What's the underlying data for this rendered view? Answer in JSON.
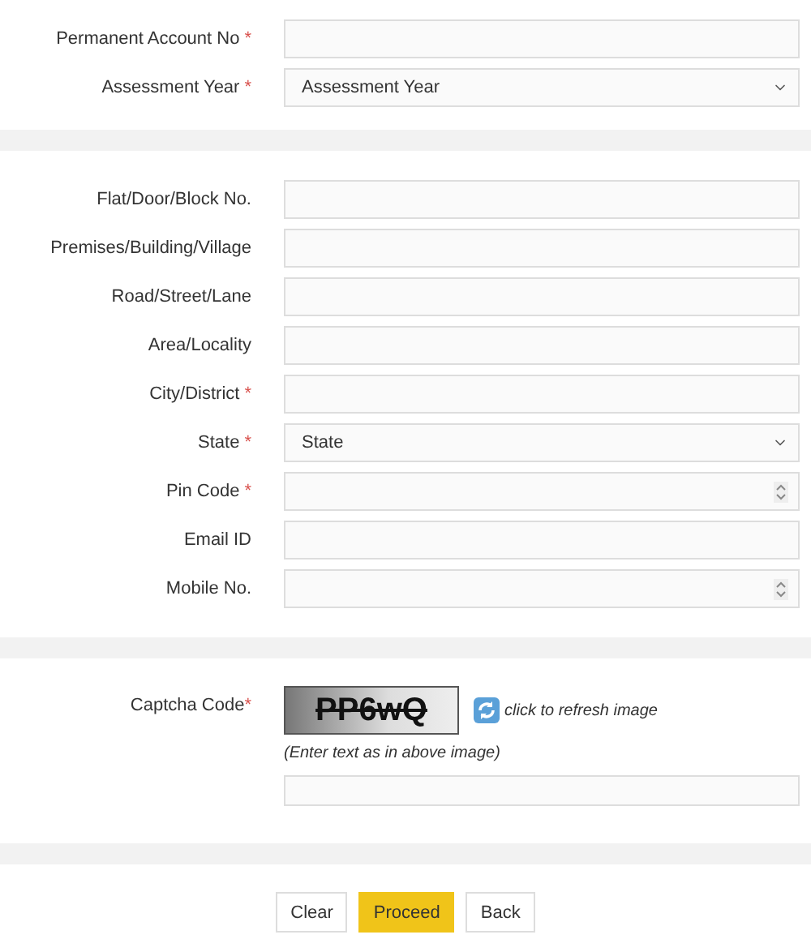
{
  "sections": [
    {
      "fields": [
        {
          "label": "Permanent Account No",
          "required_mark": "*",
          "kind": "text"
        },
        {
          "label": "Assessment Year",
          "required_mark": "*",
          "kind": "select",
          "value": "Assessment Year"
        }
      ]
    },
    {
      "fields": [
        {
          "label": "Flat/Door/Block No.",
          "kind": "text"
        },
        {
          "label": "Premises/Building/Village",
          "kind": "text"
        },
        {
          "label": "Road/Street/Lane",
          "kind": "text"
        },
        {
          "label": "Area/Locality",
          "kind": "text"
        },
        {
          "label": "City/District",
          "required_mark": "*",
          "kind": "text"
        },
        {
          "label": "State",
          "required_mark": "*",
          "kind": "select",
          "value": "State"
        },
        {
          "label": "Pin Code",
          "required_mark": "*",
          "kind": "number"
        },
        {
          "label": "Email ID",
          "kind": "text"
        },
        {
          "label": "Mobile No.",
          "kind": "number"
        }
      ]
    }
  ],
  "captcha": {
    "label": "Captcha Code",
    "required_mark": "*",
    "code": "PP6wQ",
    "refresh": "click to refresh image",
    "hint": "(Enter text as in above image)"
  },
  "buttons": [
    {
      "label": "Clear",
      "kind": "default"
    },
    {
      "label": "Proceed",
      "kind": "primary"
    },
    {
      "label": "Back",
      "kind": "default"
    }
  ]
}
